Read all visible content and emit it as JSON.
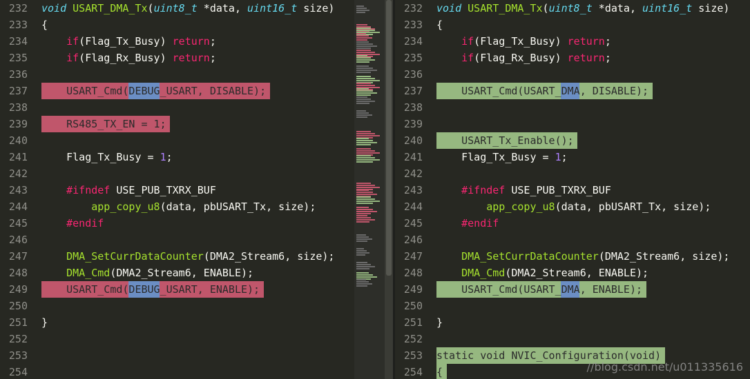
{
  "colors": {
    "bg": "#272822",
    "del": "#c0566b",
    "add": "#96b880",
    "word": "#6b8ec4"
  },
  "left": {
    "lines": [
      {
        "n": "232",
        "t": "void USART_DMA_Tx(uint8_t *data, uint16_t size)"
      },
      {
        "n": "233",
        "t": "{"
      },
      {
        "n": "234",
        "t": "    if(Flag_Tx_Busy) return;"
      },
      {
        "n": "235",
        "t": "    if(Flag_Rx_Busy) return;"
      },
      {
        "n": "236",
        "t": ""
      },
      {
        "n": "237",
        "t": "    USART_Cmd(DEBUG_USART, DISABLE);"
      },
      {
        "n": "238",
        "t": ""
      },
      {
        "n": "239",
        "t": "    RS485_TX_EN = 1;"
      },
      {
        "n": "240",
        "t": ""
      },
      {
        "n": "241",
        "t": "    Flag_Tx_Busy = 1;"
      },
      {
        "n": "242",
        "t": ""
      },
      {
        "n": "243",
        "t": "    #ifndef USE_PUB_TXRX_BUF"
      },
      {
        "n": "244",
        "t": "        app_copy_u8(data, pbUSART_Tx, size);"
      },
      {
        "n": "245",
        "t": "    #endif"
      },
      {
        "n": "246",
        "t": ""
      },
      {
        "n": "247",
        "t": "    DMA_SetCurrDataCounter(DMA2_Stream6, size);"
      },
      {
        "n": "248",
        "t": "    DMA_Cmd(DMA2_Stream6, ENABLE);"
      },
      {
        "n": "249",
        "t": "    USART_Cmd(DEBUG_USART, ENABLE);"
      },
      {
        "n": "250",
        "t": ""
      },
      {
        "n": "251",
        "t": "}"
      },
      {
        "n": "252",
        "t": ""
      },
      {
        "n": "253",
        "t": ""
      },
      {
        "n": "254",
        "t": ""
      }
    ]
  },
  "right": {
    "lines": [
      {
        "n": "232",
        "t": "void USART_DMA_Tx(uint8_t *data, uint16_t size)"
      },
      {
        "n": "233",
        "t": "{"
      },
      {
        "n": "234",
        "t": "    if(Flag_Tx_Busy) return;"
      },
      {
        "n": "235",
        "t": "    if(Flag_Rx_Busy) return;"
      },
      {
        "n": "236",
        "t": ""
      },
      {
        "n": "237",
        "t": "    USART_Cmd(USART_DMA, DISABLE);"
      },
      {
        "n": "238",
        "t": ""
      },
      {
        "n": "239",
        "t": ""
      },
      {
        "n": "240",
        "t": "    USART_Tx_Enable();"
      },
      {
        "n": "241",
        "t": "    Flag_Tx_Busy = 1;"
      },
      {
        "n": "242",
        "t": ""
      },
      {
        "n": "243",
        "t": "    #ifndef USE_PUB_TXRX_BUF"
      },
      {
        "n": "244",
        "t": "        app_copy_u8(data, pbUSART_Tx, size);"
      },
      {
        "n": "245",
        "t": "    #endif"
      },
      {
        "n": "246",
        "t": ""
      },
      {
        "n": "247",
        "t": "    DMA_SetCurrDataCounter(DMA2_Stream6, size);"
      },
      {
        "n": "248",
        "t": "    DMA_Cmd(DMA2_Stream6, ENABLE);"
      },
      {
        "n": "249",
        "t": "    USART_Cmd(USART_DMA, ENABLE);"
      },
      {
        "n": "250",
        "t": ""
      },
      {
        "n": "251",
        "t": "}"
      },
      {
        "n": "252",
        "t": ""
      },
      {
        "n": "253",
        "t": "static void NVIC_Configuration(void)"
      },
      {
        "n": "254",
        "t": "{"
      }
    ]
  },
  "watermark": "//blog.csdn.net/u011335616"
}
